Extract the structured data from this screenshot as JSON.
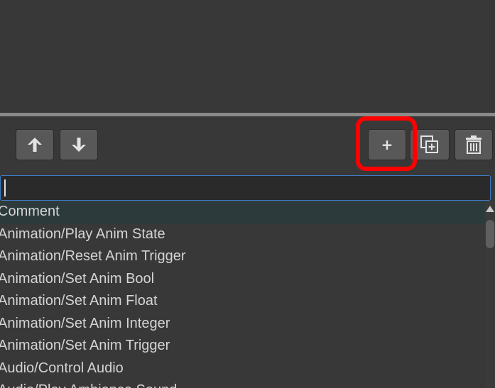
{
  "toolbar": {
    "move_up_icon": "arrow-up-icon",
    "move_down_icon": "arrow-down-icon",
    "add_label": "+",
    "duplicate_icon": "duplicate-icon",
    "delete_icon": "trash-icon",
    "highlight_color": "#ff0000"
  },
  "search": {
    "value": "",
    "placeholder": ""
  },
  "command_list": {
    "items": [
      "Comment",
      "Animation/Play Anim State",
      "Animation/Reset Anim Trigger",
      "Animation/Set Anim Bool",
      "Animation/Set Anim Float",
      "Animation/Set Anim Integer",
      "Animation/Set Anim Trigger",
      "Audio/Control Audio",
      "Audio/Play Ambience Sound"
    ],
    "selected_index": 0
  }
}
